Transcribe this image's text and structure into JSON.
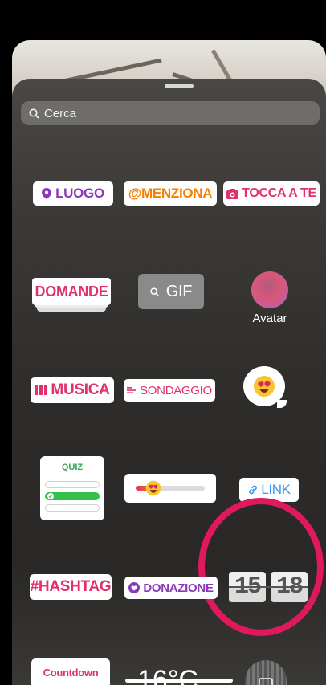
{
  "search": {
    "placeholder": "Cerca"
  },
  "stickers": {
    "luogo": "LUOGO",
    "menziona": "@MENZIONA",
    "tocca": "TOCCA A TE",
    "domande": "DOMANDE",
    "gif": "GIF",
    "avatar": "Avatar",
    "musica": "MUSICA",
    "sondaggio": "SONDAGGIO",
    "quiz": "QUIZ",
    "link": "LINK",
    "hashtag": "#HASHTAG",
    "donazione": "DONAZIONE",
    "time_h": "15",
    "time_m": "18",
    "countdown": "Countdown",
    "temperature": "16°C"
  },
  "colors": {
    "annotation_circle": "#e0195f",
    "luogo": "#8a3ab9",
    "menziona": "#f77f00",
    "pink": "#e1306c",
    "link": "#3897f0"
  }
}
